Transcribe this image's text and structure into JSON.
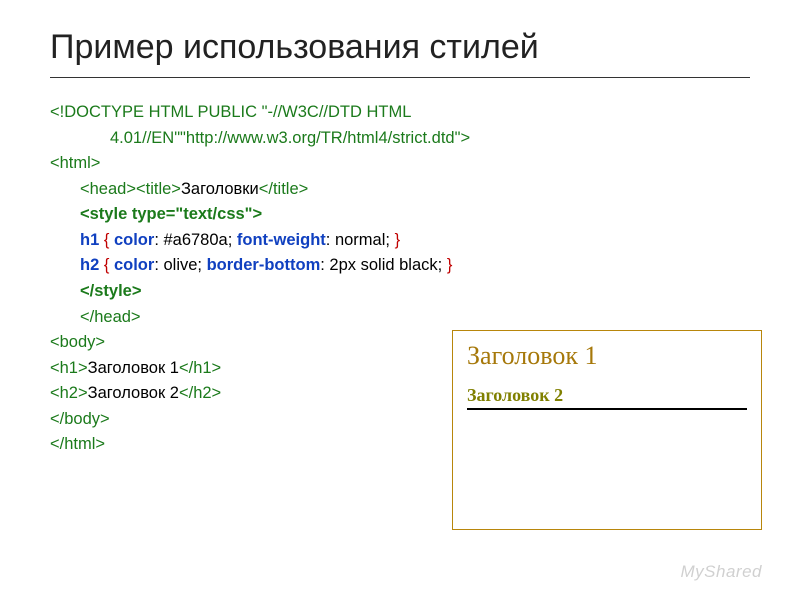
{
  "title": "Пример использования стилей",
  "code": {
    "l1": "<!DOCTYPE HTML PUBLIC \"-//W3C//DTD HTML",
    "l2": "4.01//EN\"\"http://www.w3.org/TR/html4/strict.dtd\">",
    "l3": "<html>",
    "l4a": "<head><title>",
    "l4b": "Заголовки",
    "l4c": "</title>",
    "l5": "<style type=\"text/css\">",
    "l6_sel": "h1",
    "l6_b1": "{",
    "l6_p1": "color",
    "l6_v1": ": #a6780a; ",
    "l6_p2": "font-weight",
    "l6_v2": ": normal; ",
    "l6_b2": "}",
    "l7_sel": "h2",
    "l7_b1": "{",
    "l7_p1": "color",
    "l7_v1": ": olive; ",
    "l7_p2": "border-bottom",
    "l7_v2": ": 2px solid black; ",
    "l7_b2": "}",
    "l8": "</style>",
    "l9": "</head>",
    "l10": "<body>",
    "l11a": "<h1>",
    "l11b": "Заголовок 1",
    "l11c": "</h1>",
    "l12a": "<h2>",
    "l12b": "Заголовок 2",
    "l12c": "</h2>",
    "l13": "</body>",
    "l14": "</html>"
  },
  "preview": {
    "h1": "Заголовок 1",
    "h2": "Заголовок 2"
  },
  "watermark": "MyShared"
}
